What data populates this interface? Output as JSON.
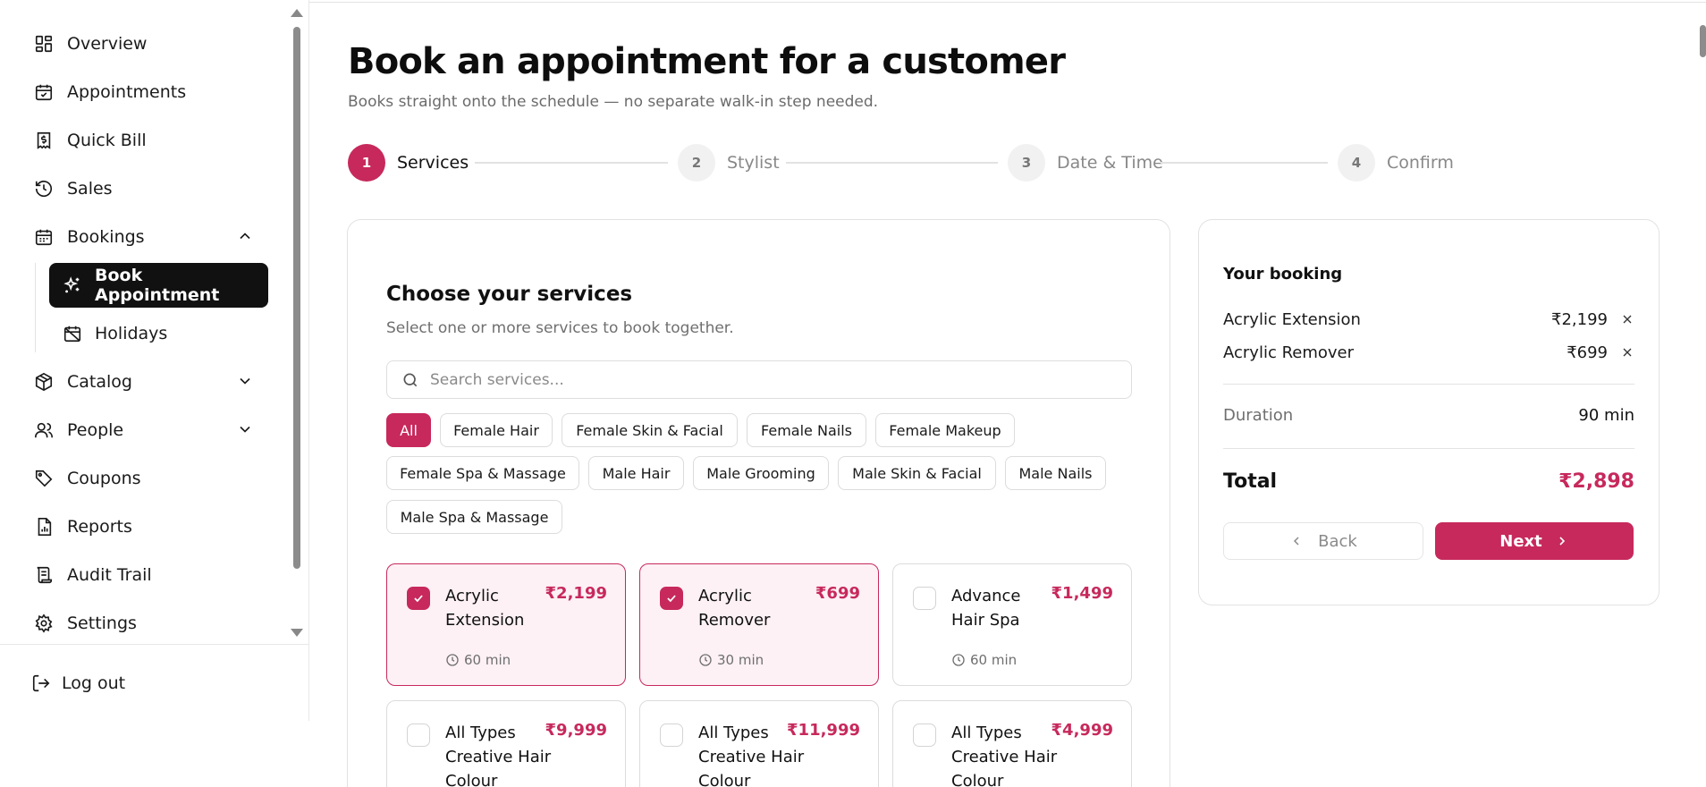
{
  "sidebar": {
    "items": [
      {
        "label": "Overview",
        "icon": "grid-icon"
      },
      {
        "label": "Appointments",
        "icon": "calendar-check-icon"
      },
      {
        "label": "Quick Bill",
        "icon": "receipt-icon"
      },
      {
        "label": "Sales",
        "icon": "history-icon"
      },
      {
        "label": "Bookings",
        "icon": "calendar-icon",
        "expanded": true
      },
      {
        "label": "Catalog",
        "icon": "box-icon",
        "expanded": false
      },
      {
        "label": "People",
        "icon": "users-icon",
        "expanded": false
      },
      {
        "label": "Coupons",
        "icon": "tag-icon"
      },
      {
        "label": "Reports",
        "icon": "report-icon"
      },
      {
        "label": "Audit Trail",
        "icon": "scroll-icon"
      },
      {
        "label": "Settings",
        "icon": "gear-icon"
      }
    ],
    "subitems": [
      {
        "label": "Book Appointment",
        "icon": "sparkle-icon",
        "active": true
      },
      {
        "label": "Holidays",
        "icon": "calendar-off-icon",
        "active": false
      }
    ],
    "logout": "Log out"
  },
  "header": {
    "title": "Book an appointment for a customer",
    "subtitle": "Books straight onto the schedule — no separate walk-in step needed."
  },
  "stepper": [
    {
      "num": "1",
      "label": "Services",
      "active": true
    },
    {
      "num": "2",
      "label": "Stylist",
      "active": false
    },
    {
      "num": "3",
      "label": "Date & Time",
      "active": false
    },
    {
      "num": "4",
      "label": "Confirm",
      "active": false
    }
  ],
  "services": {
    "title": "Choose your services",
    "subtitle": "Select one or more services to book together.",
    "search_placeholder": "Search services...",
    "filters": [
      "All",
      "Female Hair",
      "Female Skin & Facial",
      "Female Nails",
      "Female Makeup",
      "Female Spa & Massage",
      "Male Hair",
      "Male Grooming",
      "Male Skin & Facial",
      "Male Nails",
      "Male Spa & Massage"
    ],
    "active_filter": "All",
    "items": [
      {
        "name": "Acrylic Extension",
        "price": "₹2,199",
        "duration": "60 min",
        "selected": true
      },
      {
        "name": "Acrylic Remover",
        "price": "₹699",
        "duration": "30 min",
        "selected": true
      },
      {
        "name": "Advance Hair Spa",
        "price": "₹1,499",
        "duration": "60 min",
        "selected": false
      },
      {
        "name": "All Types Creative Hair Colour",
        "price": "₹9,999",
        "duration": "",
        "selected": false
      },
      {
        "name": "All Types Creative Hair Colour",
        "price": "₹11,999",
        "duration": "",
        "selected": false
      },
      {
        "name": "All Types Creative Hair Colour",
        "price": "₹4,999",
        "duration": "",
        "selected": false
      }
    ]
  },
  "booking": {
    "title": "Your booking",
    "lines": [
      {
        "name": "Acrylic Extension",
        "price": "₹2,199"
      },
      {
        "name": "Acrylic Remover",
        "price": "₹699"
      }
    ],
    "duration_label": "Duration",
    "duration_value": "90 min",
    "total_label": "Total",
    "total_value": "₹2,898",
    "back_label": "Back",
    "next_label": "Next"
  },
  "colors": {
    "accent": "#c7295c",
    "selected_bg": "#fdf1f5",
    "active_nav_bg": "#111111"
  }
}
